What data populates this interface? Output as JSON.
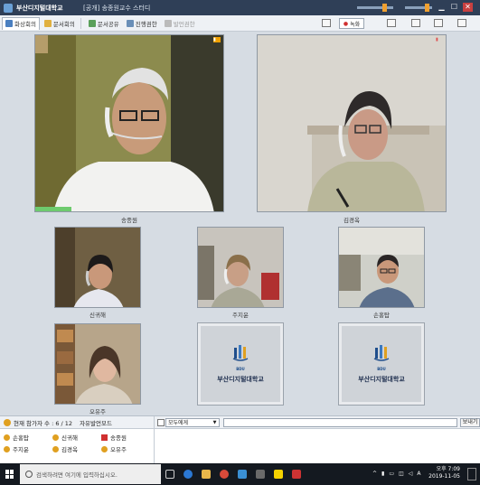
{
  "window": {
    "app_title": "부산디지털대학교",
    "center_title": "[공개] 송종원교수 스터디"
  },
  "toolbar": {
    "tabs": [
      "화상회의",
      "문서회의"
    ],
    "buttons": [
      "문서공유",
      "진행권한",
      "발언권한"
    ],
    "record_label": "녹화"
  },
  "participants_main": [
    {
      "name": "송종원"
    },
    {
      "name": "김경옥"
    }
  ],
  "participants_grid": [
    {
      "name": "신귀해"
    },
    {
      "name": "주지윤"
    },
    {
      "name": "손홍탑"
    },
    {
      "name": "오유주"
    }
  ],
  "logo_tiles": [
    {
      "mark_text": "BDU",
      "name": "부산디지털대학교"
    },
    {
      "mark_text": "BDU",
      "name": "부산디지털대학교"
    }
  ],
  "participant_panel": {
    "header_count_label": "현재 참가자 수 : 6 / 12",
    "header_mode_label": "자유발언모드",
    "list": [
      {
        "name": "손홍탑",
        "color": "#e0a020"
      },
      {
        "name": "신귀해",
        "color": "#e0a020"
      },
      {
        "name": "송종원",
        "color": "#d03030"
      },
      {
        "name": "주지윤",
        "color": "#e0a020"
      },
      {
        "name": "김경옥",
        "color": "#e0a020"
      },
      {
        "name": "오유주",
        "color": "#e0a020"
      }
    ]
  },
  "chat": {
    "recipient": "모두에게",
    "send_label": "보내기"
  },
  "taskbar": {
    "search_placeholder": "검색하려면 여기에 입력하십시오.",
    "time": "오후 7:09",
    "date": "2019-11-05"
  }
}
